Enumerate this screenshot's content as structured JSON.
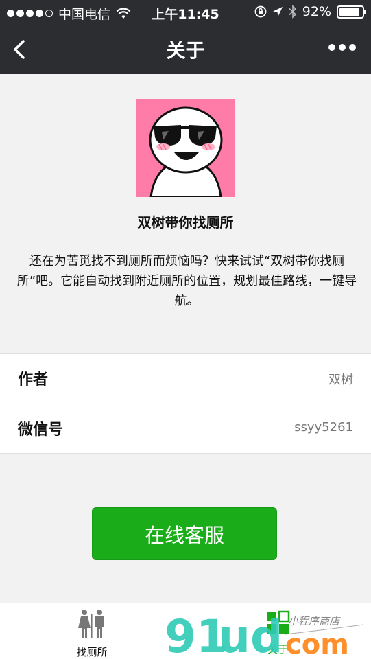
{
  "status_bar": {
    "carrier": "中国电信",
    "time": "上午11:45",
    "battery": "92%",
    "battery_level": 0.92
  },
  "nav": {
    "title": "关于"
  },
  "about": {
    "app_name": "双树带你找厕所",
    "description": "还在为苦觅找不到厕所而烦恼吗？快来试试“双树带你找厕所”吧。它能自动找到附近厕所的位置，规划最佳路线，一键导航。"
  },
  "info": [
    {
      "label": "作者",
      "value": "双树"
    },
    {
      "label": "微信号",
      "value": "ssyy5261"
    }
  ],
  "service_button": {
    "label": "在线客服"
  },
  "tabs": [
    {
      "label": "找厕所",
      "icon": "restroom-icon"
    },
    {
      "label": "关于",
      "icon": "about-grid-icon"
    }
  ],
  "watermark": {
    "text": "91ud.com",
    "subtext": "小程序商店",
    "color_primary": "#2ecbb5",
    "color_accent": "#ff8a20"
  },
  "colors": {
    "header_bg": "#2b2d30",
    "accent_green": "#1aad19",
    "logo_bg": "#ff7ba8"
  }
}
